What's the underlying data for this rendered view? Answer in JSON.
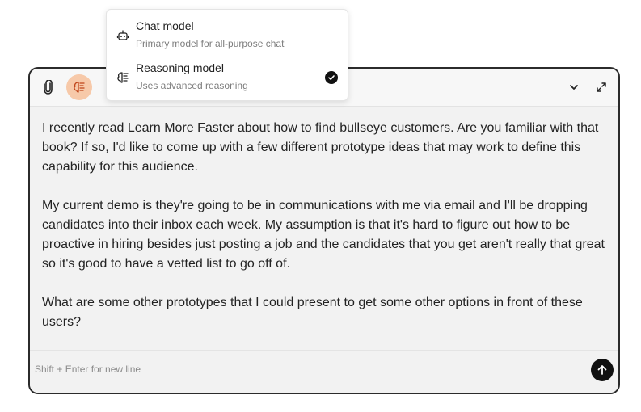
{
  "composer": {
    "message_paragraphs": [
      "I recently read Learn More Faster about how to find bullseye customers. Are you familiar with that book? If so, I'd like to come up with a few different prototype ideas that may work to define this capability for this audience.",
      "My current demo is they're going to be in communications with me via email and I'll be dropping candidates into their inbox each week. My assumption is that it's hard to figure out how to be proactive in hiring besides just posting a job and the candidates that you get aren't really that great so it's good to have a vetted list to go off of.",
      "What are some other prototypes that I could present to get some other options in front of these users?"
    ],
    "hint": "Shift + Enter for new line",
    "icons": {
      "attach": "paperclip-icon",
      "reasoning": "brain-icon",
      "chevron": "chevron-down-icon",
      "expand": "expand-icon",
      "send": "arrow-up-icon"
    },
    "accent_color": "#f7c9a9"
  },
  "model_menu": {
    "options": [
      {
        "title": "Chat model",
        "description": "Primary model for all-purpose chat",
        "icon": "robot-icon",
        "selected": false
      },
      {
        "title": "Reasoning model",
        "description": "Uses advanced reasoning",
        "icon": "brain-icon",
        "selected": true
      }
    ]
  }
}
